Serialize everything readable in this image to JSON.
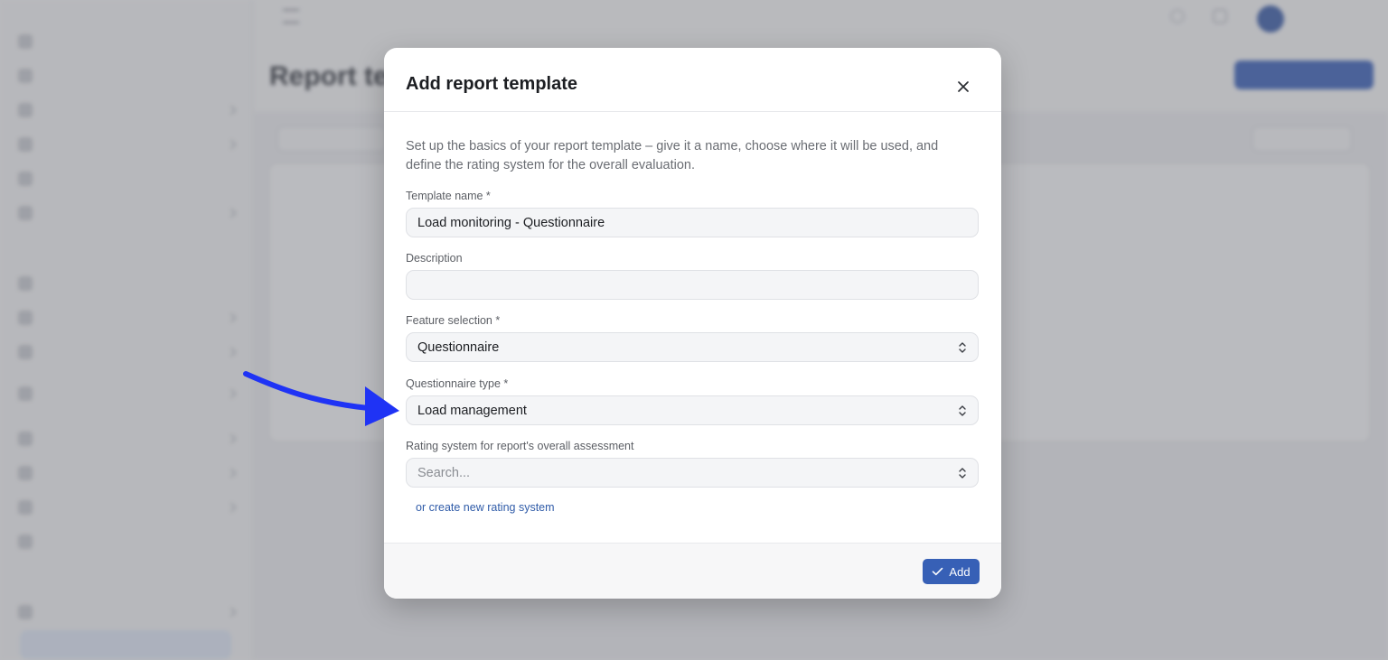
{
  "background": {
    "sidebar": {
      "heading_1": "",
      "heading_2": "",
      "heading_3": "",
      "items": [
        {
          "label": ""
        },
        {
          "label": ""
        },
        {
          "label": ""
        },
        {
          "label": ""
        },
        {
          "label": ""
        },
        {
          "label": ""
        },
        {
          "label": ""
        },
        {
          "label": ""
        },
        {
          "label": ""
        },
        {
          "label": ""
        },
        {
          "label": ""
        },
        {
          "label": ""
        },
        {
          "label": ""
        },
        {
          "label": ""
        },
        {
          "label": ""
        }
      ],
      "active_item": ""
    },
    "topbar": {
      "breadcrumb": "",
      "user_name": ""
    },
    "page_title": "Report te",
    "primary_button": "",
    "filter_placeholder": "",
    "view_toggle": "",
    "empty_title": "",
    "empty_subtitle": ""
  },
  "modal": {
    "title": "Add report template",
    "intro": "Set up the basics of your report template – give it a name, choose where it will be used, and define the rating system for the overall evaluation.",
    "template_name": {
      "label": "Template name *",
      "value": "Load monitoring - Questionnaire"
    },
    "description": {
      "label": "Description",
      "value": ""
    },
    "feature_selection": {
      "label": "Feature selection *",
      "value": "Questionnaire"
    },
    "questionnaire_type": {
      "label": "Questionnaire type *",
      "value": "Load management"
    },
    "rating_system": {
      "label": "Rating system for report's overall assessment",
      "placeholder": "Search..."
    },
    "create_link": "or create new rating system",
    "add_button": "Add"
  },
  "colors": {
    "accent": "#3760b6",
    "annotation_arrow": "#1f33f5",
    "overlay": "rgba(96,98,104,0.40)"
  },
  "icons": [
    "close-icon",
    "updown-chevron-icon",
    "check-icon",
    "annotation-arrow"
  ]
}
